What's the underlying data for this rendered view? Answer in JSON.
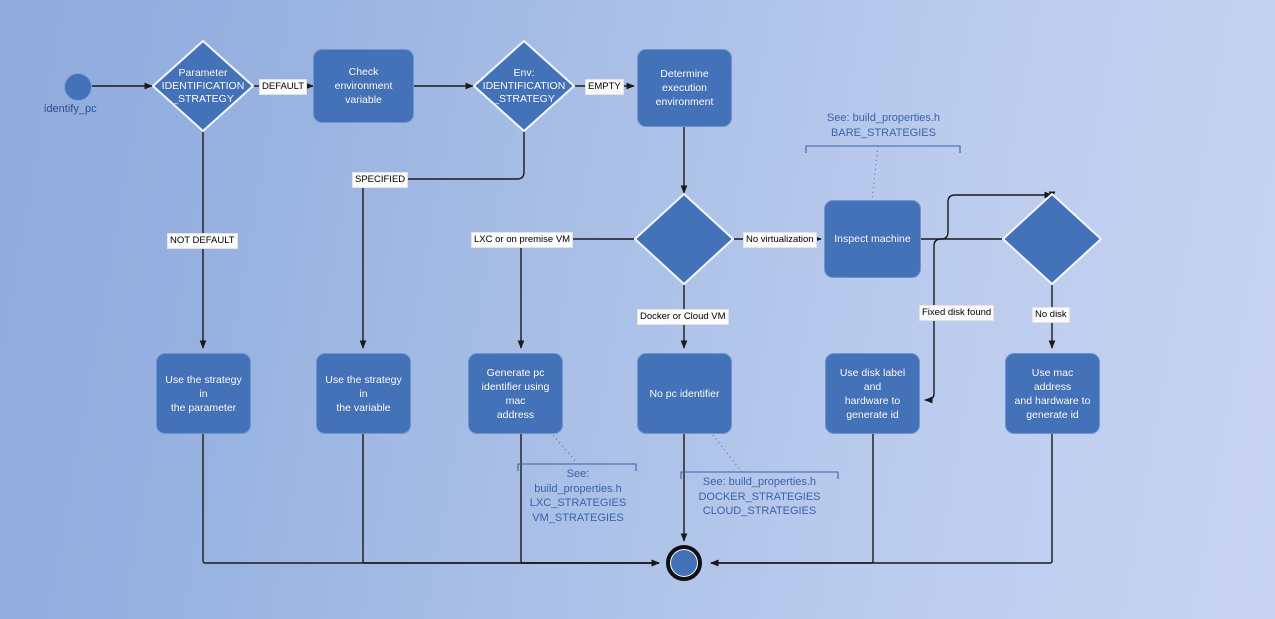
{
  "diagram": {
    "title": "identify_pc flowchart",
    "colors": {
      "node_fill": "#4472B8",
      "node_text": "#FFFFFF",
      "note_text": "#3B62A8",
      "edge_line": "#1A1A1A",
      "label_bg": "#FBFBFB",
      "bg_left": "#8FACDE",
      "bg_right": "#C7D3F1"
    },
    "start": {
      "name": "start-node",
      "label": "identify_pc"
    },
    "end": {
      "name": "end-node",
      "label": ""
    },
    "nodes": [
      {
        "id": "param-strategy",
        "type": "decision",
        "label": "Parameter\nIDENTIFICATION\n_STRATEGY"
      },
      {
        "id": "check-env",
        "type": "process",
        "label": "Check environment\nvariable"
      },
      {
        "id": "env-strategy",
        "type": "decision",
        "label": "Env:\nIDENTIFICATION\n_STRATEGY"
      },
      {
        "id": "determine-env",
        "type": "process",
        "label": "Determine\nexecution\nenvironment"
      },
      {
        "id": "virt-decision",
        "type": "decision",
        "label": ""
      },
      {
        "id": "inspect-machine",
        "type": "process",
        "label": "Inspect machine"
      },
      {
        "id": "disk-decision",
        "type": "decision",
        "label": ""
      },
      {
        "id": "use-param",
        "type": "process",
        "label": "Use the strategy in\nthe parameter"
      },
      {
        "id": "use-var",
        "type": "process",
        "label": "Use the strategy in\nthe variable"
      },
      {
        "id": "gen-mac",
        "type": "process",
        "label": "Generate pc\nidentifier using mac\naddress"
      },
      {
        "id": "no-pc-id",
        "type": "process",
        "label": "No pc identifier"
      },
      {
        "id": "use-disk-label",
        "type": "process",
        "label": "Use disk label and\nhardware to\ngenerate id"
      },
      {
        "id": "use-mac-hw",
        "type": "process",
        "label": "Use mac address\nand hardware to\ngenerate id"
      }
    ],
    "edge_labels": [
      {
        "id": "lbl-default",
        "text": "DEFAULT"
      },
      {
        "id": "lbl-empty",
        "text": "EMPTY"
      },
      {
        "id": "lbl-not-default",
        "text": "NOT DEFAULT"
      },
      {
        "id": "lbl-specified",
        "text": "SPECIFIED"
      },
      {
        "id": "lbl-lxc-vm",
        "text": "LXC or on premise VM"
      },
      {
        "id": "lbl-no-virt",
        "text": "No virtualization"
      },
      {
        "id": "lbl-docker-cloud",
        "text": "Docker or Cloud VM"
      },
      {
        "id": "lbl-fixed-disk",
        "text": "Fixed disk found"
      },
      {
        "id": "lbl-no-disk",
        "text": "No disk"
      }
    ],
    "notes": [
      {
        "id": "note-bare",
        "text": "See: build_properties.h\nBARE_STRATEGIES"
      },
      {
        "id": "note-lxc",
        "text": "See:\nbuild_properties.h\nLXC_STRATEGIES\nVM_STRATEGIES"
      },
      {
        "id": "note-docker",
        "text": "See: build_properties.h\nDOCKER_STRATEGIES\nCLOUD_STRATEGIES"
      }
    ]
  }
}
